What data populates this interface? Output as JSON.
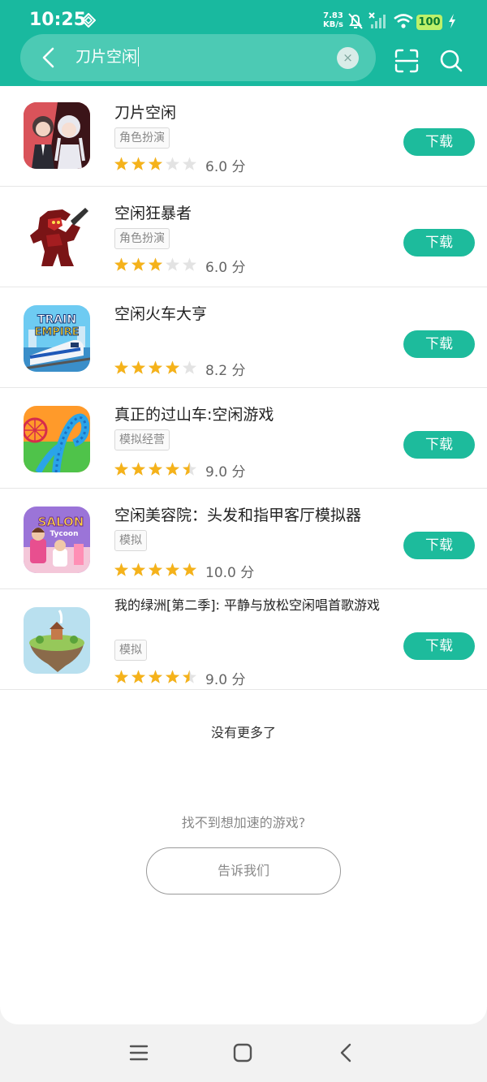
{
  "status_bar": {
    "time": "10:25",
    "net_speed_value": "7.83",
    "net_speed_unit": "KB/s",
    "battery": "100",
    "icons": [
      "vpn-diamond-icon",
      "mute-bell-icon",
      "no-signal-icon",
      "wifi-icon",
      "charging-bolt-icon"
    ]
  },
  "search": {
    "query": "刀片空闲",
    "clear_symbol": "×"
  },
  "colors": {
    "brand": "#19b99f",
    "button": "#1dbb9c",
    "star": "#f5b21a",
    "star_empty": "#e3e3e3"
  },
  "games": [
    {
      "title": "刀片空闲",
      "tag": "角色扮演",
      "rating": 3,
      "score": "6.0 分",
      "button": "下载",
      "icon": "anime-characters-icon"
    },
    {
      "title": "空闲狂暴者",
      "tag": "角色扮演",
      "rating": 3,
      "score": "6.0 分",
      "button": "下载",
      "icon": "red-berserker-icon"
    },
    {
      "title": "空闲火车大亨",
      "tag": "",
      "rating": 4,
      "score": "8.2 分",
      "button": "下载",
      "icon": "train-empire-icon"
    },
    {
      "title": "真正的过山车:空闲游戏",
      "tag": "模拟经营",
      "rating": 4.5,
      "score": "9.0 分",
      "button": "下载",
      "icon": "roller-coaster-icon"
    },
    {
      "title": "空闲美容院：头发和指甲客厅模拟器",
      "tag": "模拟",
      "rating": 5,
      "score": "10.0 分",
      "button": "下载",
      "icon": "salon-tycoon-icon"
    },
    {
      "title": "我的绿洲[第二季]: 平静与放松空闲唱首歌游戏",
      "tag": "模拟",
      "rating": 4.5,
      "score": "9.0 分",
      "button": "下载",
      "icon": "floating-island-icon"
    }
  ],
  "footer": {
    "no_more": "没有更多了",
    "cant_find": "找不到想加速的游戏?",
    "tell_us": "告诉我们"
  }
}
